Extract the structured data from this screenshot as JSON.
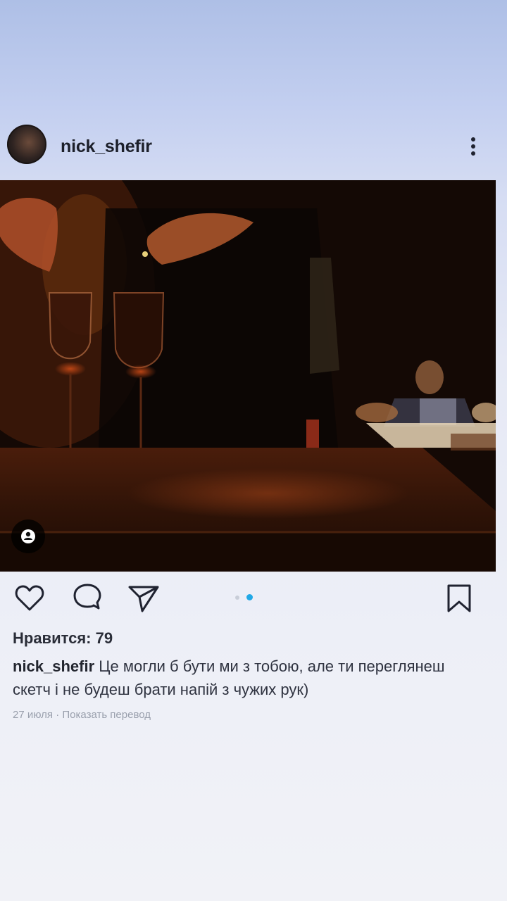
{
  "post": {
    "username": "nick_shefir",
    "likes_text": "Нравится: 79",
    "caption_user": "nick_shefir",
    "caption_text": " Це могли б бути ми з тобою, але ти переглянеш скетч і не будеш брати напій з чужих рук)",
    "date": "27 июля",
    "separator": " · ",
    "translate_link": "Показать перевод"
  },
  "icons": {
    "more": "more-vertical-icon",
    "like": "heart-icon",
    "comment": "comment-bubble-icon",
    "share": "paper-plane-icon",
    "save": "bookmark-icon",
    "tagged": "person-tag-icon"
  },
  "carousel": {
    "total": 2,
    "active": 2
  },
  "colors": {
    "accent_dot": "#21a8e6",
    "text": "#23262f",
    "meta": "#9aa0ad"
  }
}
